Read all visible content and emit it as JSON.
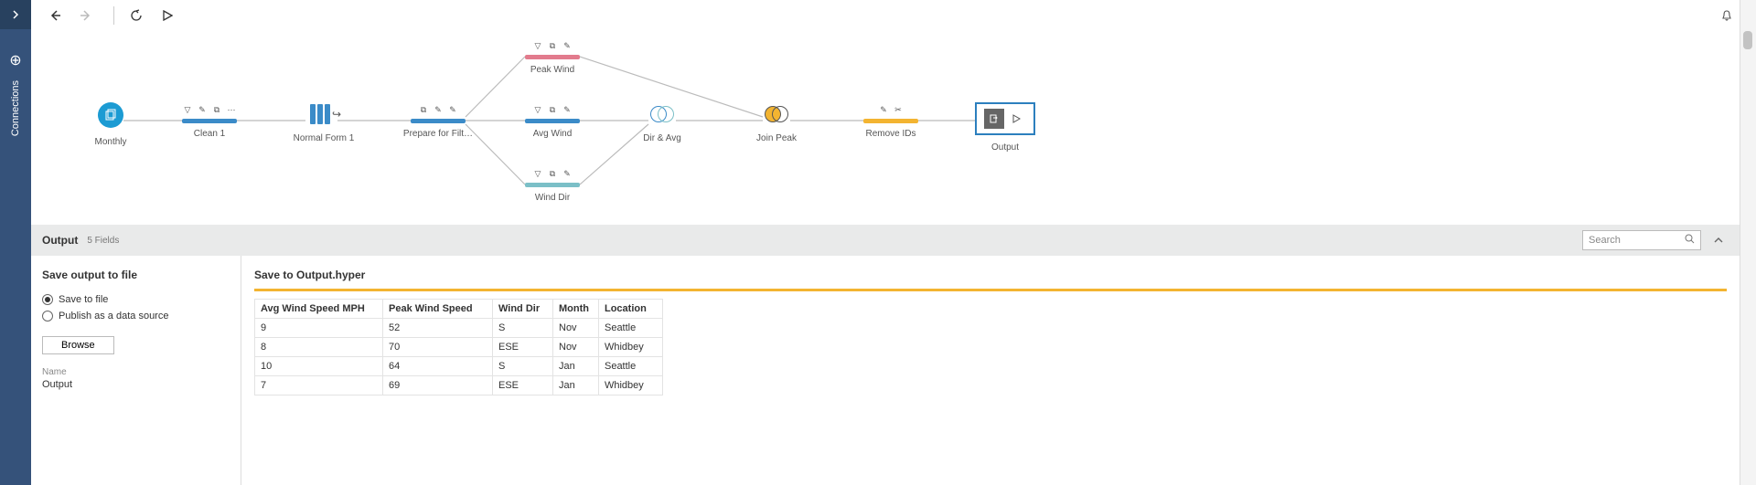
{
  "sidebar": {
    "label": "Connections"
  },
  "nodes": {
    "monthly": {
      "label": "Monthly"
    },
    "clean1": {
      "label": "Clean 1"
    },
    "normal": {
      "label": "Normal Form 1"
    },
    "prepare": {
      "label": "Prepare for Filt…"
    },
    "peak": {
      "label": "Peak Wind"
    },
    "avg": {
      "label": "Avg Wind"
    },
    "dir": {
      "label": "Wind Dir"
    },
    "join1": {
      "label": "Dir & Avg"
    },
    "join2": {
      "label": "Join Peak"
    },
    "remove": {
      "label": "Remove IDs"
    },
    "output": {
      "label": "Output"
    }
  },
  "outputHeader": {
    "title": "Output",
    "fields": "5 Fields",
    "searchPlaceholder": "Search"
  },
  "savePanel": {
    "heading": "Save output to file",
    "saveToFile": "Save to file",
    "publish": "Publish as a data source",
    "browse": "Browse",
    "nameLabel": "Name",
    "nameValue": "Output"
  },
  "dataPanel": {
    "saveTo": "Save to Output.hyper",
    "columns": [
      "Avg Wind Speed MPH",
      "Peak Wind Speed",
      "Wind Dir",
      "Month",
      "Location"
    ],
    "rows": [
      [
        "9",
        "52",
        "S",
        "Nov",
        "Seattle"
      ],
      [
        "8",
        "70",
        "ESE",
        "Nov",
        "Whidbey"
      ],
      [
        "10",
        "64",
        "S",
        "Jan",
        "Seattle"
      ],
      [
        "7",
        "69",
        "ESE",
        "Jan",
        "Whidbey"
      ]
    ]
  }
}
